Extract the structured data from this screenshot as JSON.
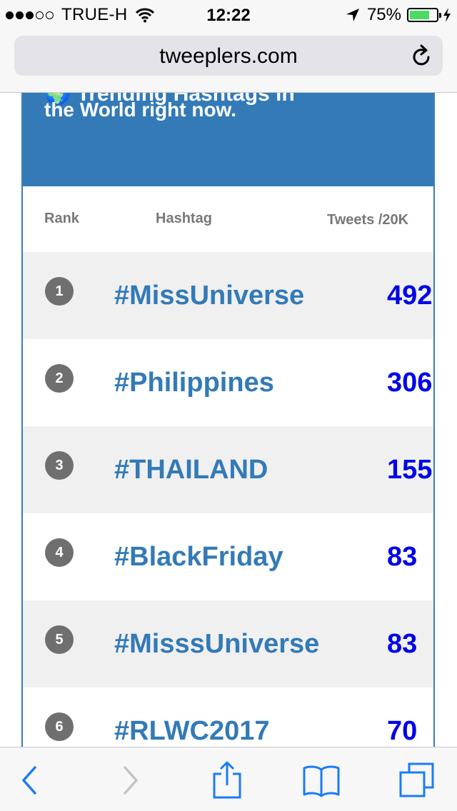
{
  "status_bar": {
    "carrier": "TRUE-H",
    "time": "12:22",
    "battery_percent": "75%",
    "battery_level": 0.75,
    "signal_bars": 3,
    "signal_max": 5
  },
  "address_bar": {
    "url": "tweeplers.com"
  },
  "banner": {
    "partial_text": "🌍 Trending Hashtags in",
    "headline": "the World right now."
  },
  "table": {
    "headers": {
      "rank": "Rank",
      "hashtag": "Hashtag",
      "tweets": "Tweets /20K"
    },
    "rows": [
      {
        "rank": "1",
        "hashtag": "#MissUniverse",
        "count": "492"
      },
      {
        "rank": "2",
        "hashtag": "#Philippines",
        "count": "306"
      },
      {
        "rank": "3",
        "hashtag": "#THAILAND",
        "count": "155"
      },
      {
        "rank": "4",
        "hashtag": "#BlackFriday",
        "count": "83"
      },
      {
        "rank": "5",
        "hashtag": "#MisssUniverse",
        "count": "83"
      },
      {
        "rank": "6",
        "hashtag": "#RLWC2017",
        "count": "70"
      }
    ]
  },
  "toolbar": {
    "icons": [
      "back-icon",
      "forward-icon",
      "share-icon",
      "bookmarks-icon",
      "tabs-icon"
    ]
  },
  "colors": {
    "accent": "#337ab7",
    "count_blue": "#0000e8",
    "row_alt": "#f0f0f0",
    "battery": "#4cd964"
  }
}
